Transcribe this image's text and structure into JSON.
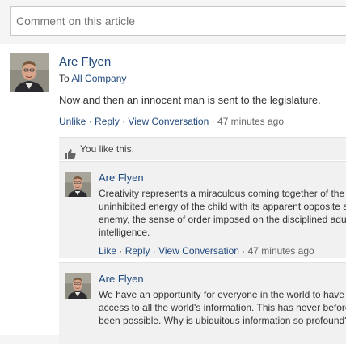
{
  "composer": {
    "placeholder": "Comment on this article"
  },
  "post": {
    "author": "Are Flyen",
    "to_prefix": "To",
    "to_target": "All Company",
    "body": "Now and then an innocent man is sent to the legislature.",
    "actions": {
      "unlike": "Unlike",
      "reply": "Reply",
      "view": "View Conversation",
      "time": "47 minutes ago"
    },
    "likes_text": "You like this."
  },
  "replies": [
    {
      "author": "Are Flyen",
      "lines": [
        "Creativity represents a miraculous coming together of the",
        "uninhibited energy of the child with its apparent opposite and",
        "enemy, the sense of order imposed on the disciplined adult",
        "intelligence."
      ],
      "actions": {
        "like": "Like",
        "reply": "Reply",
        "view": "View Conversation",
        "time": "47 minutes ago"
      }
    },
    {
      "author": "Are Flyen",
      "lines": [
        "We have an opportunity for everyone in the world to have",
        "access to all the world's information. This has never before",
        "been possible. Why is ubiquitous information so profound?"
      ]
    }
  ],
  "colors": {
    "link": "#1f497d",
    "meta": "#666666",
    "panel": "#f1f1f1"
  }
}
